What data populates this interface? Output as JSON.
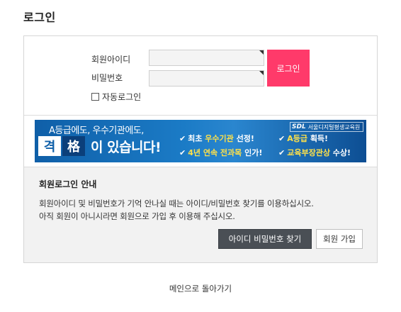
{
  "page": {
    "title": "로그인"
  },
  "form": {
    "id_label": "회원아이디",
    "pw_label": "비밀번호",
    "login_button": "로그인",
    "auto_login_label": "자동로그인",
    "id_value": "",
    "pw_value": ""
  },
  "banner": {
    "line1": "A등급에도, 우수기관에도,",
    "char1": "격",
    "char2": "格",
    "ending": "이 있습니다!",
    "logo_text": "SDL",
    "logo_sub": "서울디지털평생교육원",
    "claims": [
      {
        "prefix": "최초 ",
        "highlight": "우수기관",
        "suffix": " 선정!"
      },
      {
        "prefix": "",
        "highlight": "A등급",
        "suffix": " 획득!"
      },
      {
        "prefix": "",
        "highlight": "4년 연속 전과목",
        "suffix": " 인가!"
      },
      {
        "prefix": "",
        "highlight": "교육부장관상",
        "suffix": " 수상!"
      }
    ],
    "colors": {
      "background": "#1b7bc6",
      "highlight": "#ffe14a"
    }
  },
  "info": {
    "title": "회원로그인 안내",
    "line1": "회원아이디 및 비밀번호가 기억 안나실 때는 아이디/비밀번호 찾기를 이용하십시오.",
    "line2": "아직 회원이 아니시라면 회원으로 가입 후 이용해 주십시오.",
    "find_button": "아이디 비밀번호 찾기",
    "join_button": "회원 가입"
  },
  "footer": {
    "main_link": "메인으로 돌아가기"
  },
  "colors": {
    "login_button": "#ff3a6a",
    "find_button": "#4a4f55"
  }
}
